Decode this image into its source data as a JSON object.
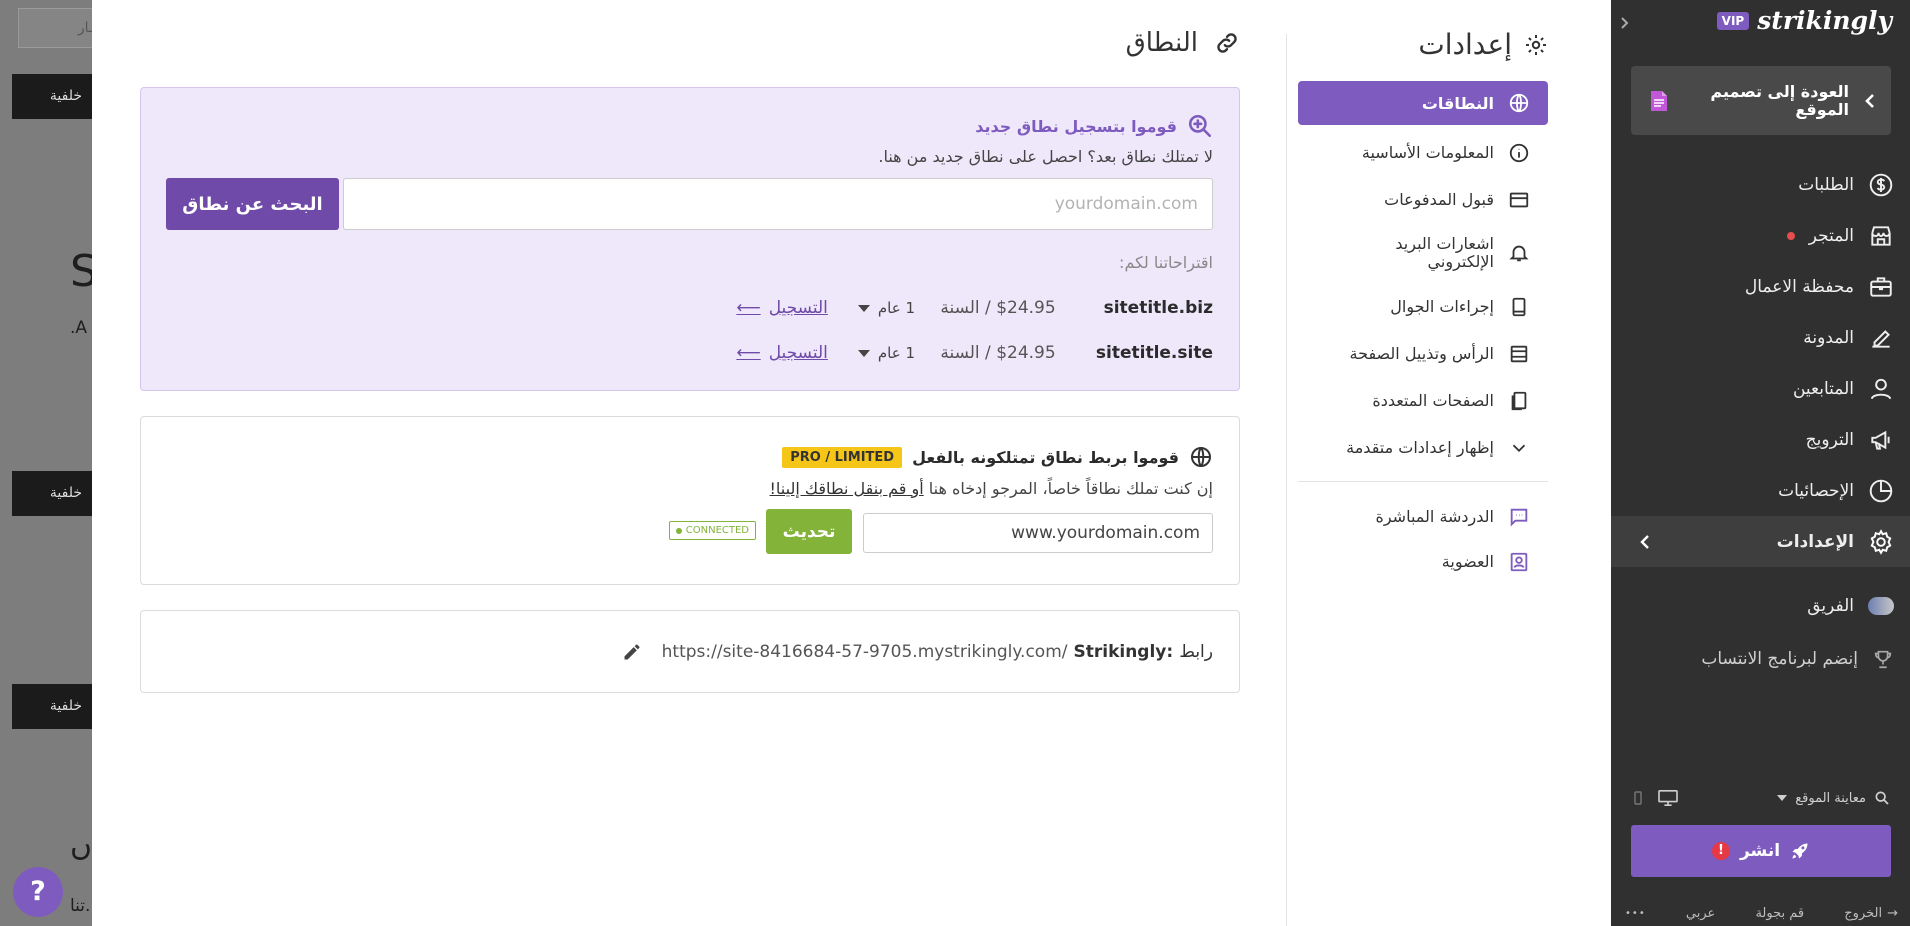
{
  "background": {
    "input_text": "ـار",
    "bar_labels": [
      "خلفية",
      "خلفية",
      "خلفية"
    ],
    "large_letter": "S",
    "small_text": ".A",
    "bottom_letter": "ں",
    "bottom_text": "تنا.",
    "help_label": "?"
  },
  "content": {
    "title": "النطاق",
    "register": {
      "heading": "قوموا بتسجيل نطاق جديد",
      "subtitle": "لا تمتلك نطاق بعد؟ احصل على نطاق جديد من هنا.",
      "search_placeholder": "yourdomain.com",
      "search_button": "البحث عن نطاق",
      "suggestions_label": "اقتراحاتنا لكم:",
      "suggestions": [
        {
          "domain": "sitetitle.biz",
          "price": "$24.95 / السنة",
          "term": "1 عام",
          "action": "التسجيل"
        },
        {
          "domain": "sitetitle.site",
          "price": "$24.95 / السنة",
          "term": "1 عام",
          "action": "التسجيل"
        }
      ]
    },
    "connect": {
      "heading": "قوموا بربط نطاق تمتلكونه بالفعل",
      "badge": "PRO / LIMITED",
      "desc_prefix": "إن كنت تملك نطاقاً خاصاً، المرجو إدخاه هنا",
      "desc_or": "أو",
      "desc_link": "قم بنقل نطاقك إلينا!",
      "input_value": "www.yourdomain.com",
      "update_button": "تحديث",
      "status_badge": "CONNECTED"
    },
    "url": {
      "label_prefix": "رابط",
      "label_brand": "Strikingly:",
      "value": "https://site-8416684-57-9705.mystrikingly.com/"
    }
  },
  "settings_nav": {
    "title": "إعدادات",
    "items": [
      {
        "label": "النطاقات",
        "icon": "globe-icon"
      },
      {
        "label": "المعلومات الأساسية",
        "icon": "info-icon"
      },
      {
        "label": "قبول المدفوعات",
        "icon": "card-icon"
      },
      {
        "label": "اشعارات البريد الإلكتروني",
        "icon": "bell-icon"
      },
      {
        "label": "إجراءات الجوال",
        "icon": "mobile-icon"
      },
      {
        "label": "الرأس وتذييل الصفحة",
        "icon": "header-footer-icon"
      },
      {
        "label": "الصفحات المتعددة",
        "icon": "pages-icon"
      },
      {
        "label": "إظهار إعدادات متقدمة",
        "icon": "chevron-down-icon"
      }
    ],
    "extra_items": [
      {
        "label": "الدردشة المباشرة",
        "icon": "chat-icon"
      },
      {
        "label": "العضوية",
        "icon": "membership-icon"
      }
    ],
    "accent_color": "#7e5bbe"
  },
  "sidebar": {
    "brand": "strikingly",
    "vip": "VIP",
    "back_label": "العودة إلى تصميم الموقع",
    "items": [
      {
        "label": "الطلبات",
        "icon": "dollar-icon"
      },
      {
        "label": "المتجر",
        "icon": "store-icon"
      },
      {
        "label": "محفظة الاعمال",
        "icon": "briefcase-icon"
      },
      {
        "label": "المدونة",
        "icon": "pen-icon"
      },
      {
        "label": "المتابعين",
        "icon": "user-icon"
      },
      {
        "label": "الترويج",
        "icon": "megaphone-icon"
      },
      {
        "label": "الإحصائيات",
        "icon": "pie-icon"
      },
      {
        "label": "الإعدادات",
        "icon": "gear-icon"
      }
    ],
    "team_label": "الفريق",
    "affiliate_label": "إنضم لبرنامج الانتساب",
    "preview_label": "معاينة الموقع",
    "publish_label": "انشر",
    "publish_alert": "!",
    "footer": {
      "logout": "الخروج",
      "tour": "قم بجولة",
      "language": "عربي",
      "more": "•••"
    },
    "colors": {
      "background": "#303030",
      "publish": "#7e5bbe",
      "alert": "#e63946"
    }
  }
}
